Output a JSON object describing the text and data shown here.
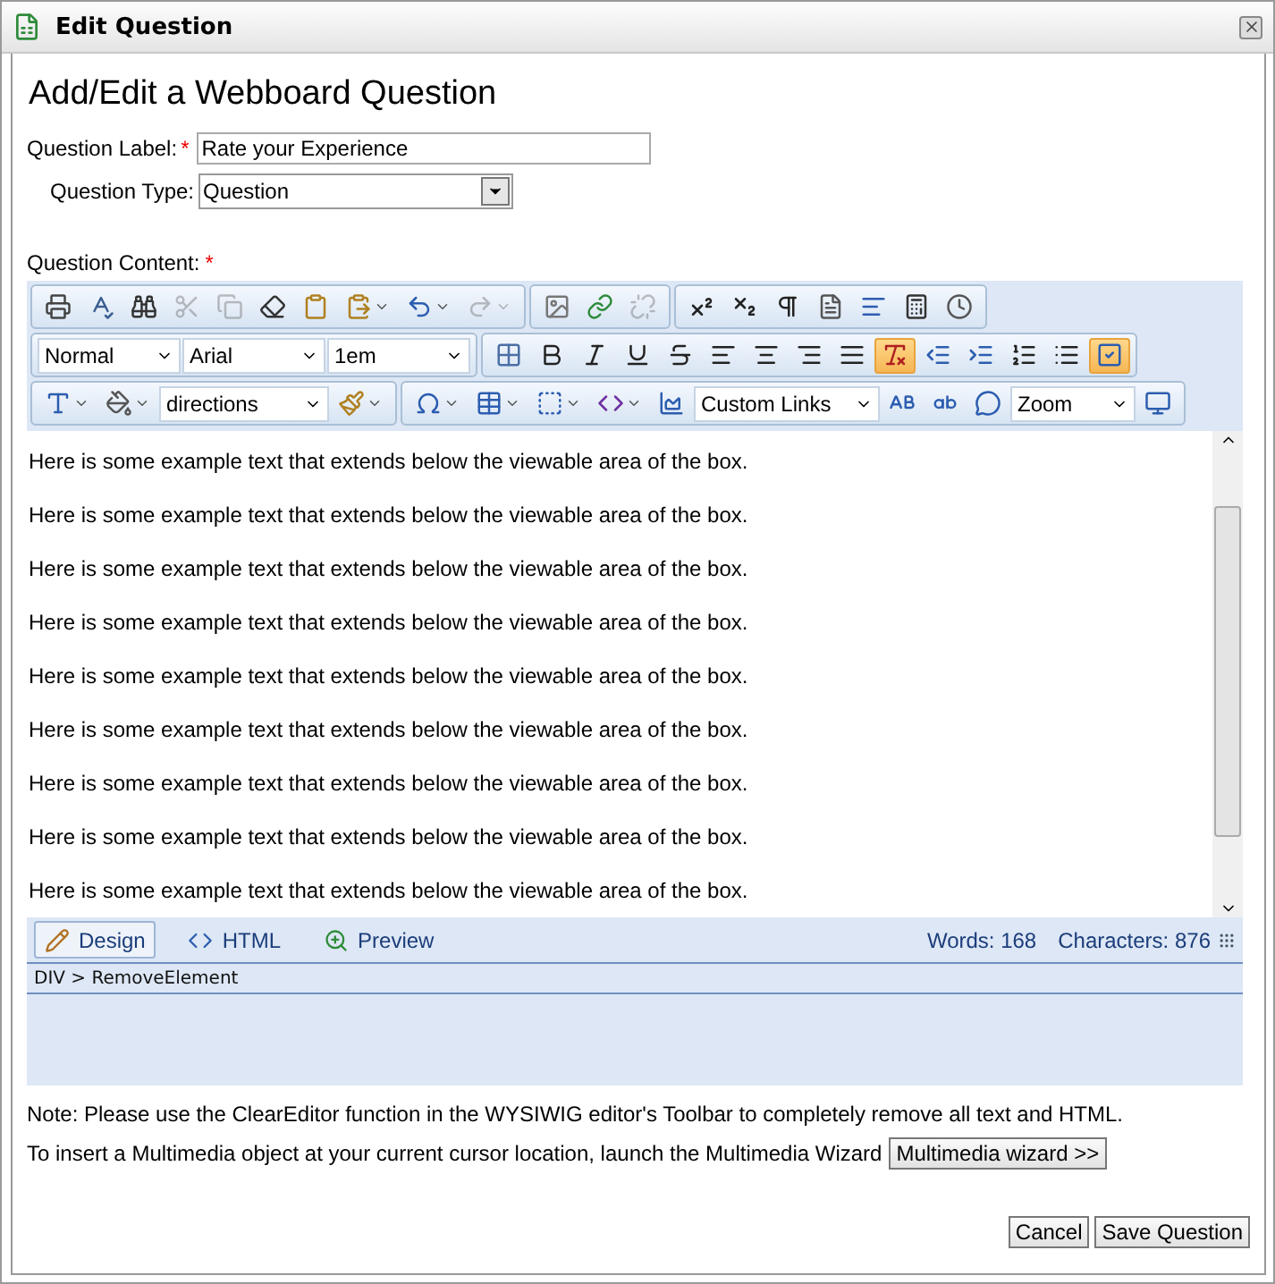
{
  "window": {
    "title": "Edit Question"
  },
  "heading": "Add/Edit a Webboard Question",
  "label_field": {
    "label": "Question Label:",
    "required_mark": "*",
    "value": "Rate your Experience"
  },
  "type_field": {
    "label": "Question Type:",
    "value": "Question"
  },
  "content_label": {
    "label": "Question Content:",
    "required_mark": "*"
  },
  "toolbar": {
    "rows": [
      [
        [
          {
            "kind": "button",
            "active": false,
            "disabled": false
          },
          {
            "kind": "button",
            "active": false,
            "disabled": false
          },
          {
            "kind": "button",
            "active": false,
            "disabled": false
          },
          {
            "kind": "button",
            "active": false,
            "disabled": true
          },
          {
            "kind": "button",
            "active": false,
            "disabled": true
          },
          {
            "kind": "button",
            "active": false,
            "disabled": false
          },
          {
            "kind": "button",
            "active": false,
            "disabled": false
          },
          {
            "kind": "split",
            "active": false,
            "disabled": false
          },
          {
            "kind": "split",
            "active": false,
            "disabled": false
          },
          {
            "kind": "split",
            "active": false,
            "disabled": true
          }
        ],
        [
          {
            "kind": "button",
            "active": false,
            "disabled": false
          },
          {
            "kind": "button",
            "active": false,
            "disabled": false
          },
          {
            "kind": "button",
            "active": false,
            "disabled": true
          }
        ],
        [
          {
            "kind": "button",
            "active": false,
            "disabled": false
          },
          {
            "kind": "button",
            "active": false,
            "disabled": false
          },
          {
            "kind": "button",
            "active": false,
            "disabled": false
          },
          {
            "kind": "button",
            "active": false,
            "disabled": false
          },
          {
            "kind": "button",
            "active": false,
            "disabled": false
          },
          {
            "kind": "button",
            "active": false,
            "disabled": false
          },
          {
            "kind": "button",
            "active": false,
            "disabled": false
          }
        ]
      ],
      [
        [
          {
            "kind": "dropdown",
            "value": "Normal"
          },
          {
            "kind": "dropdown",
            "value": "Arial"
          },
          {
            "kind": "dropdown",
            "value": "1em"
          }
        ],
        [
          {
            "kind": "button",
            "active": false,
            "disabled": false
          },
          {
            "kind": "button",
            "active": false,
            "disabled": false
          },
          {
            "kind": "button",
            "active": false,
            "disabled": false
          },
          {
            "kind": "button",
            "active": false,
            "disabled": false
          },
          {
            "kind": "button",
            "active": false,
            "disabled": false
          },
          {
            "kind": "button",
            "active": false,
            "disabled": false
          },
          {
            "kind": "button",
            "active": false,
            "disabled": false
          },
          {
            "kind": "button",
            "active": false,
            "disabled": false
          },
          {
            "kind": "button",
            "active": false,
            "disabled": false
          },
          {
            "kind": "button",
            "active": true,
            "disabled": false
          },
          {
            "kind": "button",
            "active": false,
            "disabled": false
          },
          {
            "kind": "button",
            "active": false,
            "disabled": false
          },
          {
            "kind": "button",
            "active": false,
            "disabled": false
          },
          {
            "kind": "button",
            "active": false,
            "disabled": false
          },
          {
            "kind": "button",
            "active": true,
            "disabled": false
          }
        ]
      ],
      [
        [
          {
            "kind": "split",
            "active": false,
            "disabled": false
          },
          {
            "kind": "split",
            "active": false,
            "disabled": false
          },
          {
            "kind": "dropdown",
            "value": "directions"
          },
          {
            "kind": "split",
            "active": false,
            "disabled": false
          }
        ],
        [
          {
            "kind": "split",
            "active": false,
            "disabled": false
          },
          {
            "kind": "split",
            "active": false,
            "disabled": false
          },
          {
            "kind": "split",
            "active": false,
            "disabled": false
          },
          {
            "kind": "split",
            "active": false,
            "disabled": false
          },
          {
            "kind": "button",
            "active": false,
            "disabled": false
          },
          {
            "kind": "dropdown",
            "value": "Custom Links"
          },
          {
            "kind": "button",
            "active": false,
            "disabled": false
          },
          {
            "kind": "button",
            "active": false,
            "disabled": false
          },
          {
            "kind": "button",
            "active": false,
            "disabled": false
          },
          {
            "kind": "dropdown",
            "value": "Zoom"
          },
          {
            "kind": "button",
            "active": false,
            "disabled": false
          }
        ]
      ]
    ]
  },
  "paragraphs": [
    "Here is some example text that extends below the viewable area of the box.",
    "Here is some example text that extends below the viewable area of the box.",
    "Here is some example text that extends below the viewable area of the box.",
    "Here is some example text that extends below the viewable area of the box.",
    "Here is some example text that extends below the viewable area of the box.",
    "Here is some example text that extends below the viewable area of the box.",
    "Here is some example text that extends below the viewable area of the box.",
    "Here is some example text that extends below the viewable area of the box.",
    "Here is some example text that extends below the viewable area of the box."
  ],
  "mode_tabs": [
    {
      "label": "Design",
      "selected": true
    },
    {
      "label": "HTML",
      "selected": false
    },
    {
      "label": "Preview",
      "selected": false
    }
  ],
  "stats": {
    "words": "Words: 168",
    "characters": "Characters: 876"
  },
  "path": "DIV > RemoveElement",
  "note": "Note: Please use the ClearEditor function in the WYSIWIG editor's Toolbar to completely remove all text and HTML.",
  "multimedia": {
    "text": "To insert a Multimedia object at your current cursor location, launch the Multimedia Wizard",
    "button": "Multimedia wizard >>"
  },
  "buttons": [
    "Cancel",
    "Save Question"
  ]
}
